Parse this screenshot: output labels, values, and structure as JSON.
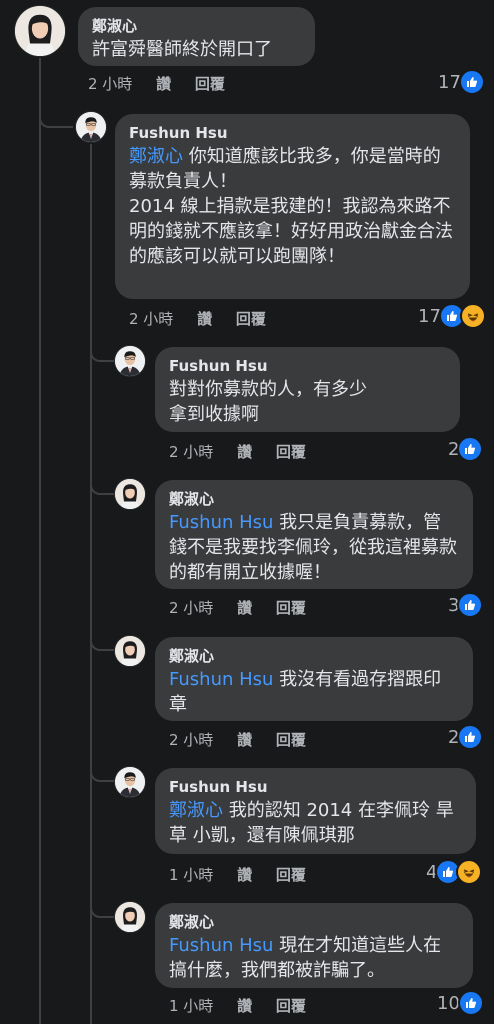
{
  "comments": [
    {
      "author": "鄭淑心",
      "mention": "",
      "text": "許富舜醫師終於開口了",
      "time": "2 小時",
      "like_label": "讚",
      "reply_label": "回覆",
      "reaction_count": "17",
      "reactions": [
        "like-icon"
      ]
    },
    {
      "author": "Fushun Hsu",
      "mention": "鄭淑心",
      "text": "你知道應該比我多，你是當時的募款負責人！\n2014 線上捐款是我建的！我認為來路不明的錢就不應該拿！好好用政治獻金合法的應該可以就可以跑團隊！",
      "time": "2 小時",
      "like_label": "讚",
      "reply_label": "回覆",
      "reaction_count": "17",
      "reactions": [
        "like-icon",
        "haha-icon"
      ]
    },
    {
      "author": "Fushun Hsu",
      "mention": "",
      "text": "對對你募款的人，有多少拿到收據啊",
      "time": "2 小時",
      "like_label": "讚",
      "reply_label": "回覆",
      "reaction_count": "2",
      "reactions": [
        "like-icon"
      ]
    },
    {
      "author": "鄭淑心",
      "mention": "Fushun Hsu",
      "text": "我只是負責募款，管錢不是我要找李佩玲，從我這裡募款的都有開立收據喔！",
      "time": "2 小時",
      "like_label": "讚",
      "reply_label": "回覆",
      "reaction_count": "3",
      "reactions": [
        "like-icon"
      ]
    },
    {
      "author": "鄭淑心",
      "mention": "Fushun Hsu",
      "text": "我沒有看過存摺跟印章",
      "time": "2 小時",
      "like_label": "讚",
      "reply_label": "回覆",
      "reaction_count": "2",
      "reactions": [
        "like-icon"
      ]
    },
    {
      "author": "Fushun Hsu",
      "mention": "鄭淑心",
      "text": "我的認知 2014 在李佩玲 旱草 小凱，還有陳佩琪那",
      "time": "1 小時",
      "like_label": "讚",
      "reply_label": "回覆",
      "reaction_count": "4",
      "reactions": [
        "like-icon",
        "haha-icon"
      ]
    },
    {
      "author": "鄭淑心",
      "mention": "Fushun Hsu",
      "text": "現在才知道這些人在搞什麼，我們都被詐騙了。",
      "time": "1 小時",
      "like_label": "讚",
      "reply_label": "回覆",
      "reaction_count": "10",
      "reactions": [
        "like-icon"
      ]
    }
  ]
}
